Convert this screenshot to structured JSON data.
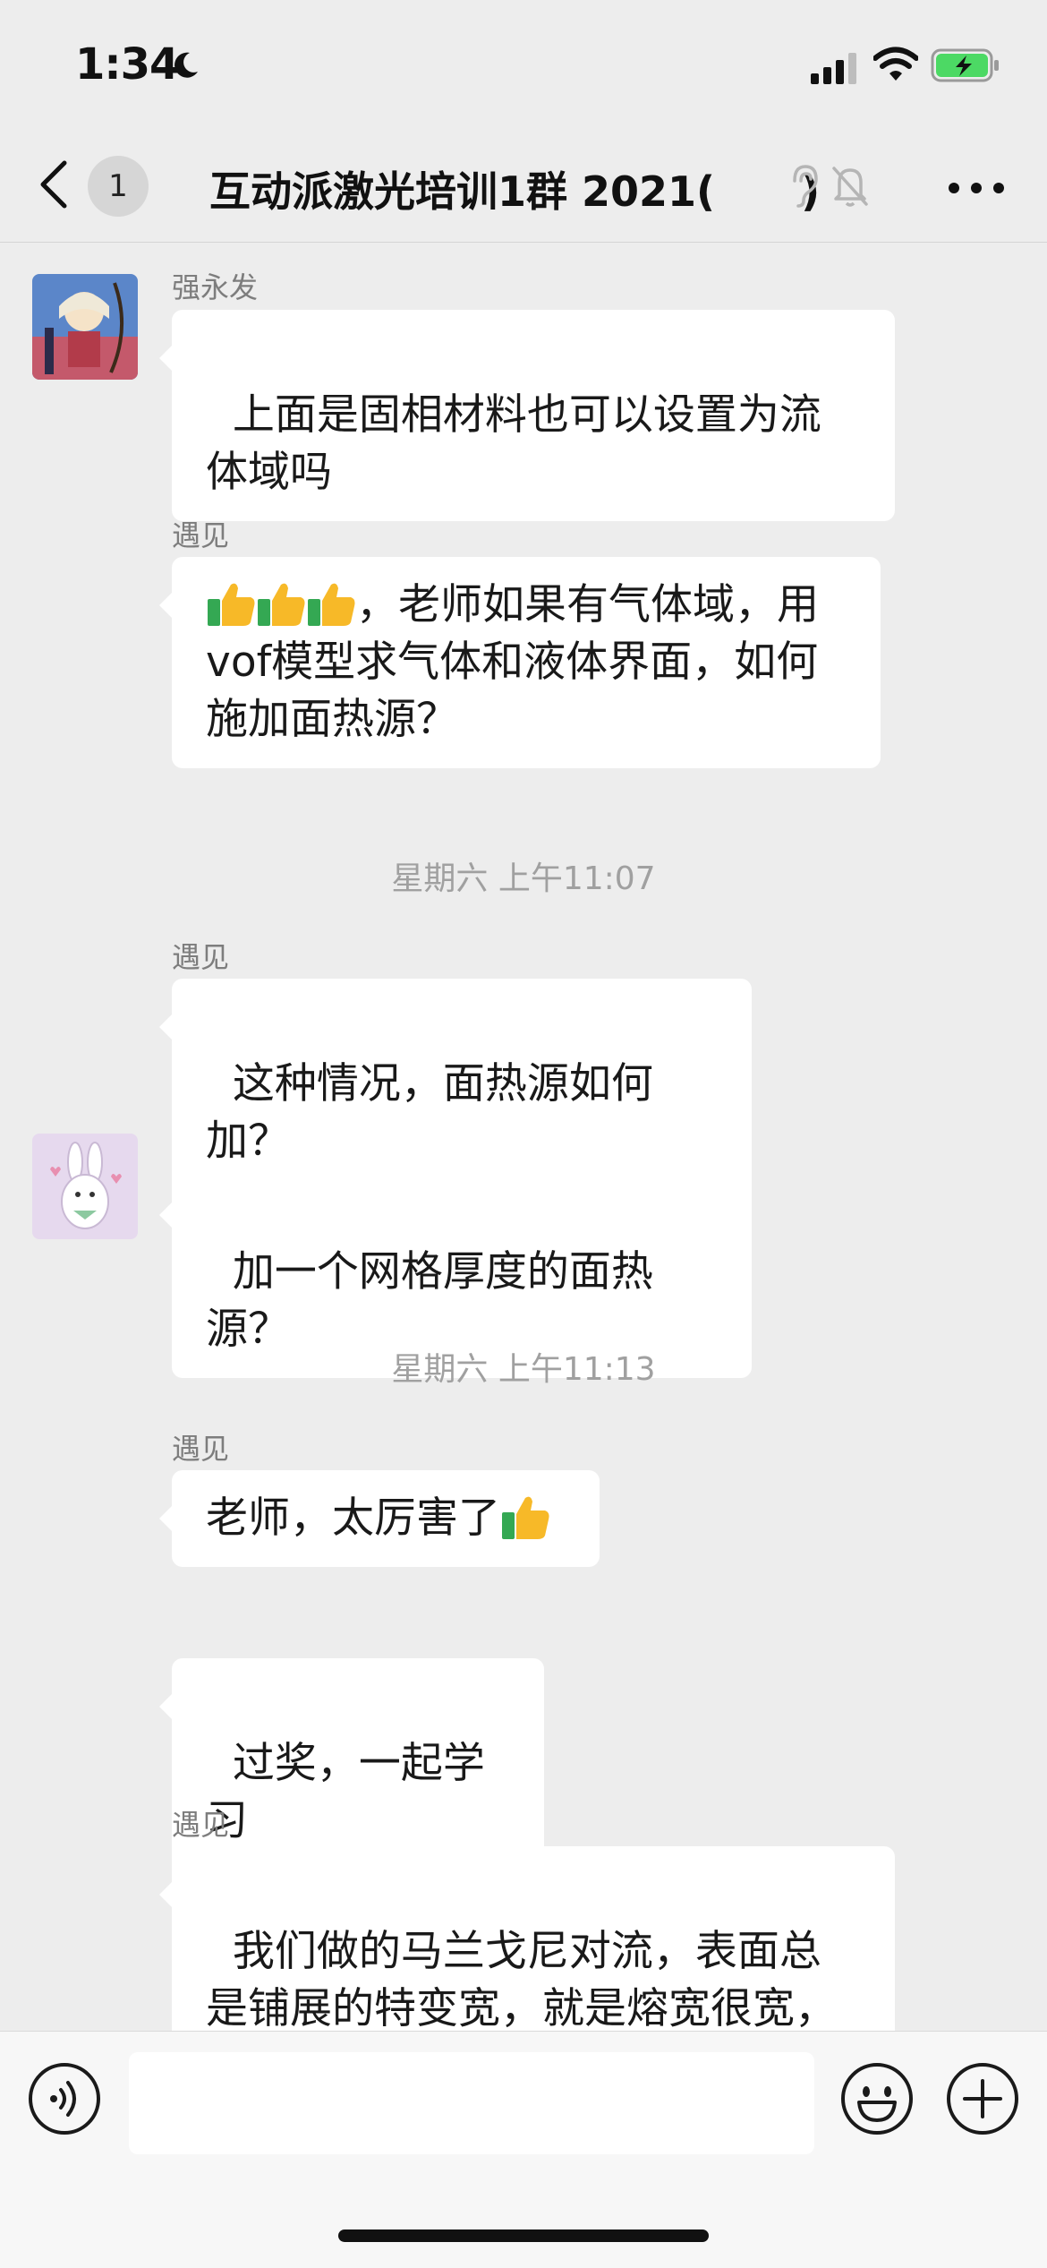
{
  "status_bar": {
    "time": "1:34",
    "moon_icon": "moon-icon",
    "signal_icon": "cellular-signal-icon",
    "wifi_icon": "wifi-icon",
    "battery_icon": "battery-charging-icon",
    "battery_color": "#4cd964"
  },
  "header": {
    "back_icon": "chevron-left-icon",
    "unread_count": "1",
    "title": "互动派激光培训1群 2021(      )",
    "ear_icon": "ear-icon",
    "mute_icon": "bell-slash-icon",
    "more_icon": "more-dots-icon"
  },
  "messages": [
    {
      "sender": "强永发",
      "text": "上面是固相材料也可以设置为流体域吗",
      "avatar": "anime-girl-avatar"
    },
    {
      "sender": "遇见",
      "text": "，老师如果有气体域，用vof模型求气体和液体界面，如何施加面热源？",
      "emoji": "thumbs-up-icon"
    },
    {
      "timestamp": "星期六 上午11:07"
    },
    {
      "sender": "遇见",
      "text": "这种情况，面热源如何加？"
    },
    {
      "sender": "",
      "text": "加一个网格厚度的面热源？",
      "avatar": "rabbit-avatar"
    },
    {
      "timestamp": "星期六 上午11:13"
    },
    {
      "sender": "遇见",
      "text": "老师，太厉害了"
    },
    {
      "sender": "",
      "text": "过奖，一起学习"
    },
    {
      "sender": "遇见",
      "text": "我们做的马兰戈尼对流，表面总是铺展的特变宽，就是熔宽很宽，"
    }
  ],
  "input_bar": {
    "voice_icon": "voice-icon",
    "emoji_icon": "smiley-icon",
    "plus_icon": "plus-circle-icon",
    "input_value": ""
  },
  "colors": {
    "background": "#ededed",
    "bubble": "#ffffff",
    "thumb_yellow": "#f7b928",
    "thumb_green": "#34a853"
  }
}
